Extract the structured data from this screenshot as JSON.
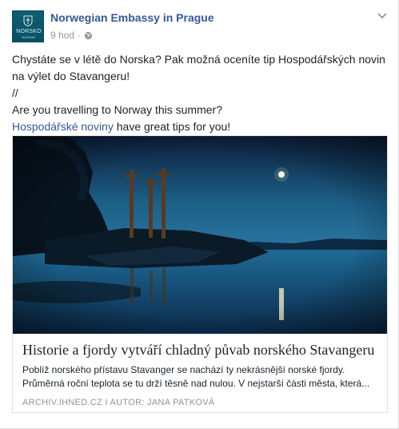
{
  "post": {
    "page_name": "Norwegian Embassy in Prague",
    "timestamp": "9 hod",
    "separator": "·",
    "privacy_icon": "globe-icon",
    "menu_icon": "chevron-down-icon",
    "avatar": {
      "logo_text": "NORSKO",
      "logo_subtext": "NORWAY"
    },
    "text": {
      "line1": "Chystáte se v létě do Norska? Pak možná oceníte tip Hospodářských novin na výlet do Stavangeru!",
      "divider": "//",
      "line2": "Are you travelling to Norway this summer?",
      "link": "Hospodářské noviny",
      "line3_rest": " have great tips for you!"
    }
  },
  "link_card": {
    "title": "Historie a fjordy vytváří chladný půvab norského Stavangeru",
    "description": "Poblíž norského přístavu Stavanger se nachází ty nekrásnější norské fjordy. Průměrná roční teplota se tu drží těsně nad nulou. V nejstarší části města, která...",
    "source": "ARCHIV.IHNED.CZ  I  AUTOR: JANA PATKOVÁ"
  },
  "colors": {
    "link_blue": "#365899",
    "meta_gray": "#90949c",
    "text": "#1d2129"
  }
}
